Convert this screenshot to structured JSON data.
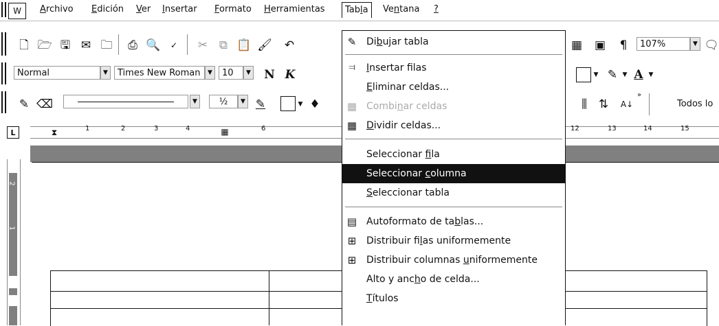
{
  "menubar": {
    "items": [
      {
        "label": "Archivo"
      },
      {
        "label": "Edición"
      },
      {
        "label": "Ver"
      },
      {
        "label": "Insertar"
      },
      {
        "label": "Formato"
      },
      {
        "label": "Herramientas"
      },
      {
        "label": "Tabla"
      },
      {
        "label": "Ventana"
      },
      {
        "label": "?"
      }
    ]
  },
  "standard_toolbar": {
    "zoom": "107%",
    "pilcrow": "¶"
  },
  "format_toolbar": {
    "style": "Normal",
    "font": "Times New Roman",
    "size": "10",
    "bold": "N",
    "italic": "K",
    "font_color_letter": "A"
  },
  "drawing_toolbar": {
    "line_weight": "½",
    "sort_label": "Todos lo"
  },
  "ruler": {
    "numbers": [
      "1",
      "2",
      "3",
      "4",
      "6",
      "12",
      "13",
      "14",
      "15"
    ],
    "vertical_numbers": [
      "2",
      "1"
    ]
  },
  "table_menu": {
    "items": [
      {
        "label": "Dibujar tabla",
        "icon": "pencil-icon"
      },
      {
        "label": "Insertar filas",
        "icon": "insert-rows-icon"
      },
      {
        "label": "Eliminar celdas...",
        "icon": ""
      },
      {
        "label": "Combinar celdas",
        "icon": "merge-cells-icon",
        "disabled": true
      },
      {
        "label": "Dividir celdas...",
        "icon": "split-cells-icon"
      },
      {
        "label": "Seleccionar fila",
        "icon": ""
      },
      {
        "label": "Seleccionar columna",
        "icon": "",
        "highlighted": true
      },
      {
        "label": "Seleccionar tabla",
        "icon": ""
      },
      {
        "label": "Autoformato de tablas...",
        "icon": "autoformat-icon"
      },
      {
        "label": "Distribuir filas uniformemente",
        "icon": "distribute-rows-icon"
      },
      {
        "label": "Distribuir columnas uniformemente",
        "icon": "distribute-columns-icon"
      },
      {
        "label": "Alto y ancho de celda...",
        "icon": ""
      },
      {
        "label": "Títulos",
        "icon": ""
      }
    ]
  },
  "colors": {
    "highlight": "#111111",
    "background": "#ffffff",
    "ruler_gray": "#808080"
  }
}
